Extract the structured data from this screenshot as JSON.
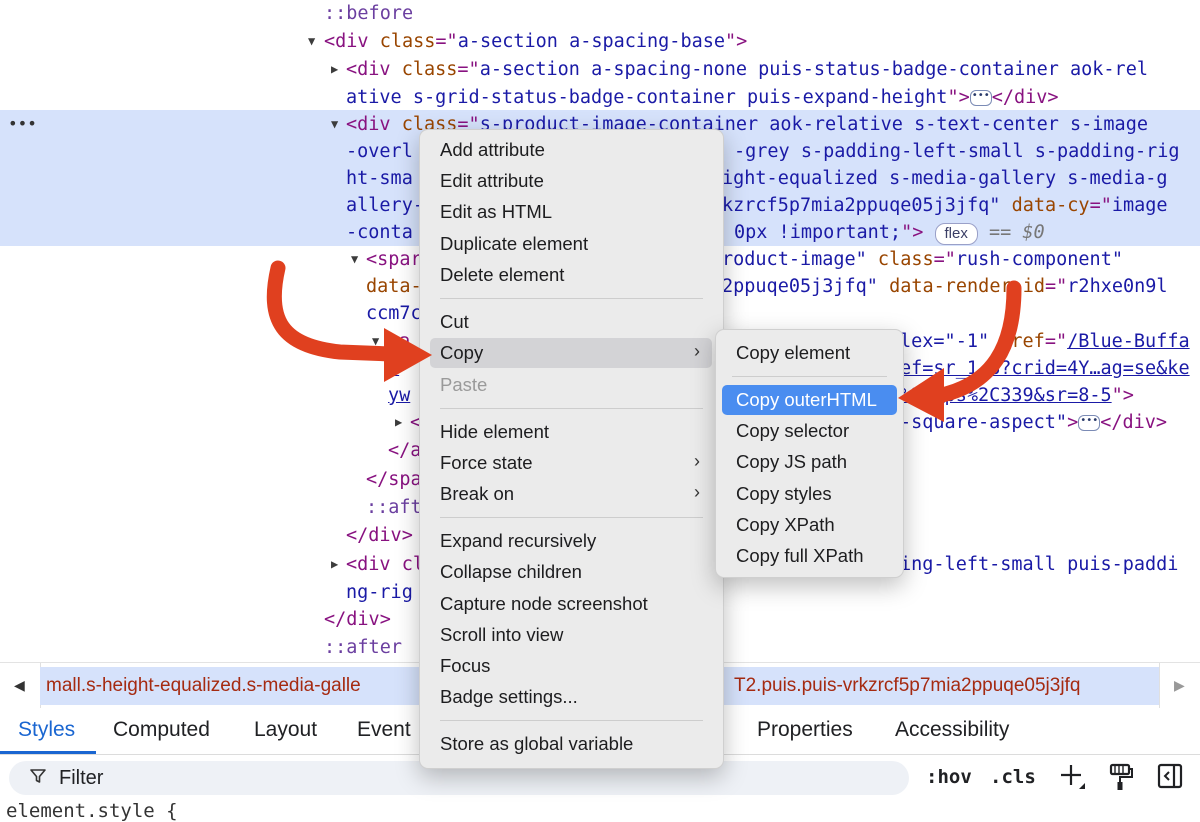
{
  "elements_panel": {
    "lines": {
      "l1": "::before",
      "l2_tag": "<div ",
      "l2_an": "class",
      "l2_eq": "=\"",
      "l2_av": "a-section a-spacing-base",
      "l2_end": "\">",
      "l3_tag": "<div ",
      "l3_an": "class",
      "l3_eq": "=\"",
      "l3_av": "a-section a-spacing-none puis-status-badge-container aok-rel",
      "l4_av": "ative s-grid-status-badge-container puis-expand-height",
      "l4_q": "\">",
      "l4_ell": "•••",
      "l4_close": "</div>",
      "l5_tag": "<div ",
      "l5_an": "class",
      "l5_eq": "=\"",
      "l5_av": "s-product-image-container aok-relative s-text-center s-image",
      "l6a": "-overl",
      "l6b": "-grey s-padding-left-small s-padding-rig",
      "l7a": "ht-sma",
      "l7b": "ight-equalized s-media-gallery s-media-g",
      "l8a": "allery-",
      "l8b": "kzrcf5p7mia2ppuqe05j3jfq\"",
      "l8c": " data-cy",
      "l8d": "=\"",
      "l8e": "image",
      "l9a": "-conta",
      "l9b": "0px !important;",
      "l9c": "\">",
      "l9_badge": "flex",
      "l9_eq": "== $0",
      "l10a": "<spar",
      "l10b": "roduct-image\"",
      "l10c": " class",
      "l10d": "=\"",
      "l10e": "rush-component\"",
      "l11a": "data-",
      "l11b": "2ppuqe05j3jfq\"",
      "l11c": " data-render-id",
      "l11d": "=\"",
      "l11e": "r2hxe0n9l",
      "l12a": "ccm7c",
      "l13a": "<a",
      "l13b": "lex=\"-1\"",
      "l13c": " href",
      "l13d": "=\"",
      "l13e": "/Blue-Buffa",
      "l14a": "…",
      "l14b": "ef=sr_1_8?crid=4Y…ag=se&ke",
      "l15a": "yw",
      "l15b": "%2Caps%2C339&sr=8-5",
      "l15c": "\">",
      "l16a": "<",
      "l16b": "-square-aspect\"",
      "l16c": ">",
      "l16_ell": "•••",
      "l16_close": "</div>",
      "l17": "</a",
      "l18": "</spa",
      "l19": "::aft",
      "l20": "</div>",
      "l21a": "<div cl",
      "l21b": "ing-left-small puis-paddi",
      "l22": "ng-rig",
      "l23": "</div>",
      "l24": "::after"
    },
    "row_dots": "•••"
  },
  "breadcrumb": {
    "left_text": "mall.s-height-equalized.s-media-galle",
    "right_text": "T2.puis.puis-vrkzrcf5p7mia2ppuqe05j3jfq",
    "left_arrow": "◀",
    "right_arrow": "▶"
  },
  "tabs": {
    "styles": "Styles",
    "computed": "Computed",
    "layout": "Layout",
    "event": "Event",
    "properties": "Properties",
    "accessibility": "Accessibility"
  },
  "filter": {
    "label": "Filter",
    "hov": ":hov",
    "cls": ".cls"
  },
  "element_style": "element.style {",
  "context_menu": {
    "add_attribute": "Add attribute",
    "edit_attribute": "Edit attribute",
    "edit_as_html": "Edit as HTML",
    "duplicate_element": "Duplicate element",
    "delete_element": "Delete element",
    "cut": "Cut",
    "copy": "Copy",
    "paste": "Paste",
    "hide_element": "Hide element",
    "force_state": "Force state",
    "break_on": "Break on",
    "expand_recursively": "Expand recursively",
    "collapse_children": "Collapse children",
    "capture_node_screenshot": "Capture node screenshot",
    "scroll_into_view": "Scroll into view",
    "focus": "Focus",
    "badge_settings": "Badge settings...",
    "store_as_global_variable": "Store as global variable"
  },
  "copy_submenu": {
    "copy_element": "Copy element",
    "copy_outerhtml": "Copy outerHTML",
    "copy_selector": "Copy selector",
    "copy_js_path": "Copy JS path",
    "copy_styles": "Copy styles",
    "copy_xpath": "Copy XPath",
    "copy_full_xpath": "Copy full XPath"
  },
  "colors": {
    "selection_bg": "#d6e2fb",
    "tab_accent": "#1a66d1",
    "menu_selected": "#4a8df0",
    "annotation_arrow": "#e0401f"
  },
  "icons": [
    "expand-triangle-icon",
    "collapse-triangle-icon",
    "filter-funnel-icon",
    "plus-icon",
    "paint-roller-icon",
    "sidebar-toggle-icon",
    "chevron-right-icon"
  ]
}
